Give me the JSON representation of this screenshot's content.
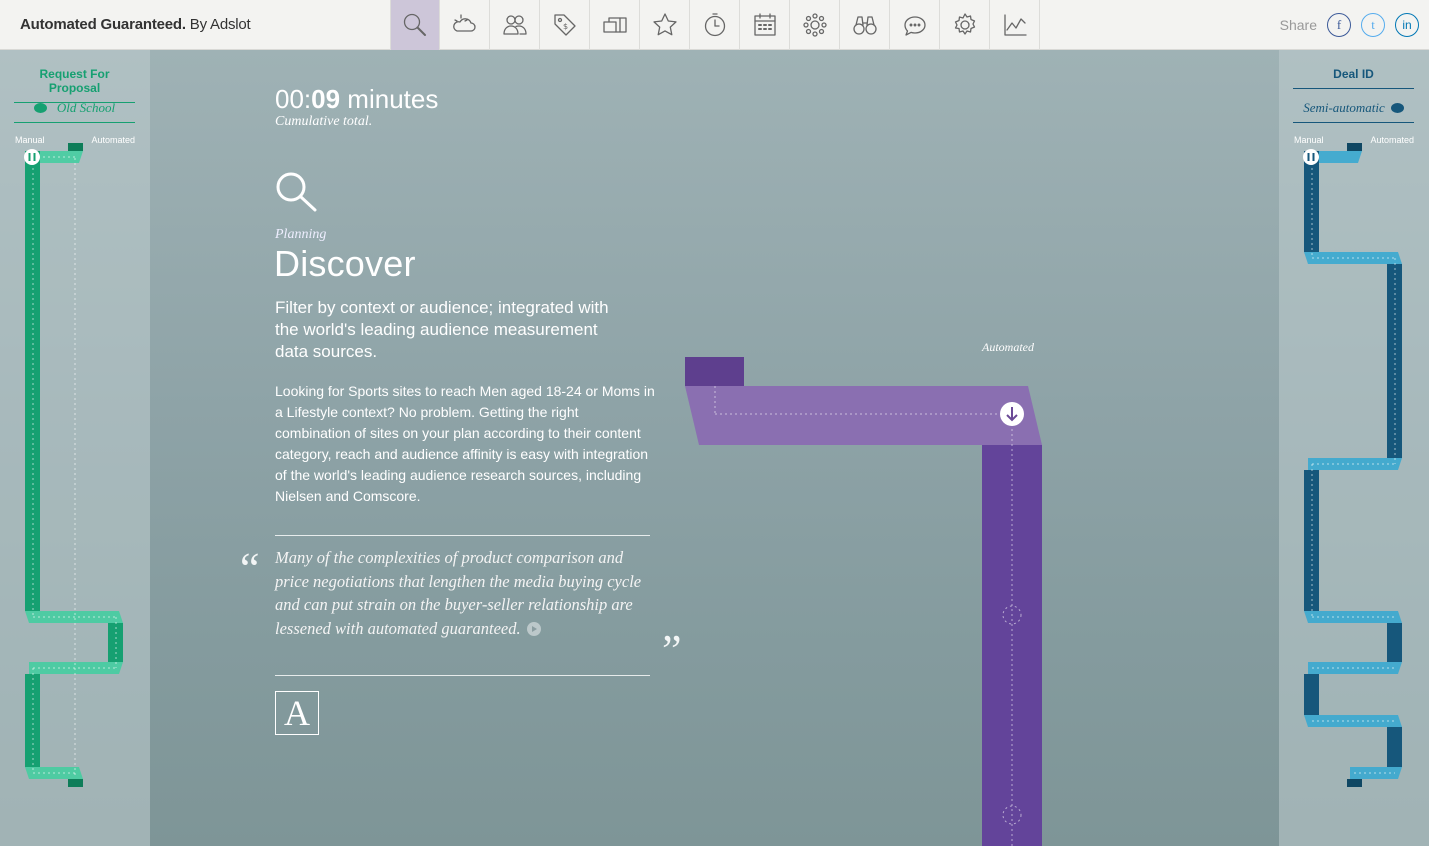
{
  "header": {
    "brand_bold": "Automated Guaranteed.",
    "brand_rest": " By Adslot",
    "nav_icons": [
      "search-icon",
      "cloud-sun-icon",
      "people-icon",
      "price-tag-icon",
      "screens-icon",
      "star-icon",
      "stopwatch-icon",
      "calendar-icon",
      "network-icon",
      "binoculars-icon",
      "chat-icon",
      "gear-icon",
      "line-chart-icon"
    ],
    "active_nav": "search-icon",
    "share_label": "Share",
    "social": {
      "facebook": "f",
      "twitter": "t",
      "linkedin": "in"
    }
  },
  "left_panel": {
    "title": "Request For Proposal",
    "mode": "Old School",
    "manual_label": "Manual",
    "automated_label": "Automated",
    "color": "#16a071"
  },
  "right_panel": {
    "title": "Deal ID",
    "mode": "Semi-automatic",
    "manual_label": "Manual",
    "automated_label": "Automated",
    "color": "#16577b"
  },
  "main": {
    "timer_prefix": "00:",
    "timer_value": "09",
    "timer_suffix": " minutes",
    "timer_note": "Cumulative total.",
    "category": "Planning",
    "headline": "Discover",
    "lede": "Filter by context or audience; integrated with the world's leading audience measurement data sources.",
    "body": "Looking for Sports sites to reach Men aged 18-24 or Moms in a Lifestyle context? No problem. Getting the right combination of sites on your plan according to their content category, reach and audience affinity is easy with integration of the world's leading audience research sources, including Nielsen and Comscore.",
    "quote": "Many of the complexities of product comparison and price negotiations that lengthen the media buying cycle and can put strain on the buyer-seller relationship are lessened with automated guaranteed.",
    "quote_open": "“",
    "quote_close": "”",
    "logo_letter": "A",
    "track_label": "Automated",
    "track_color": "#6b4a96"
  }
}
